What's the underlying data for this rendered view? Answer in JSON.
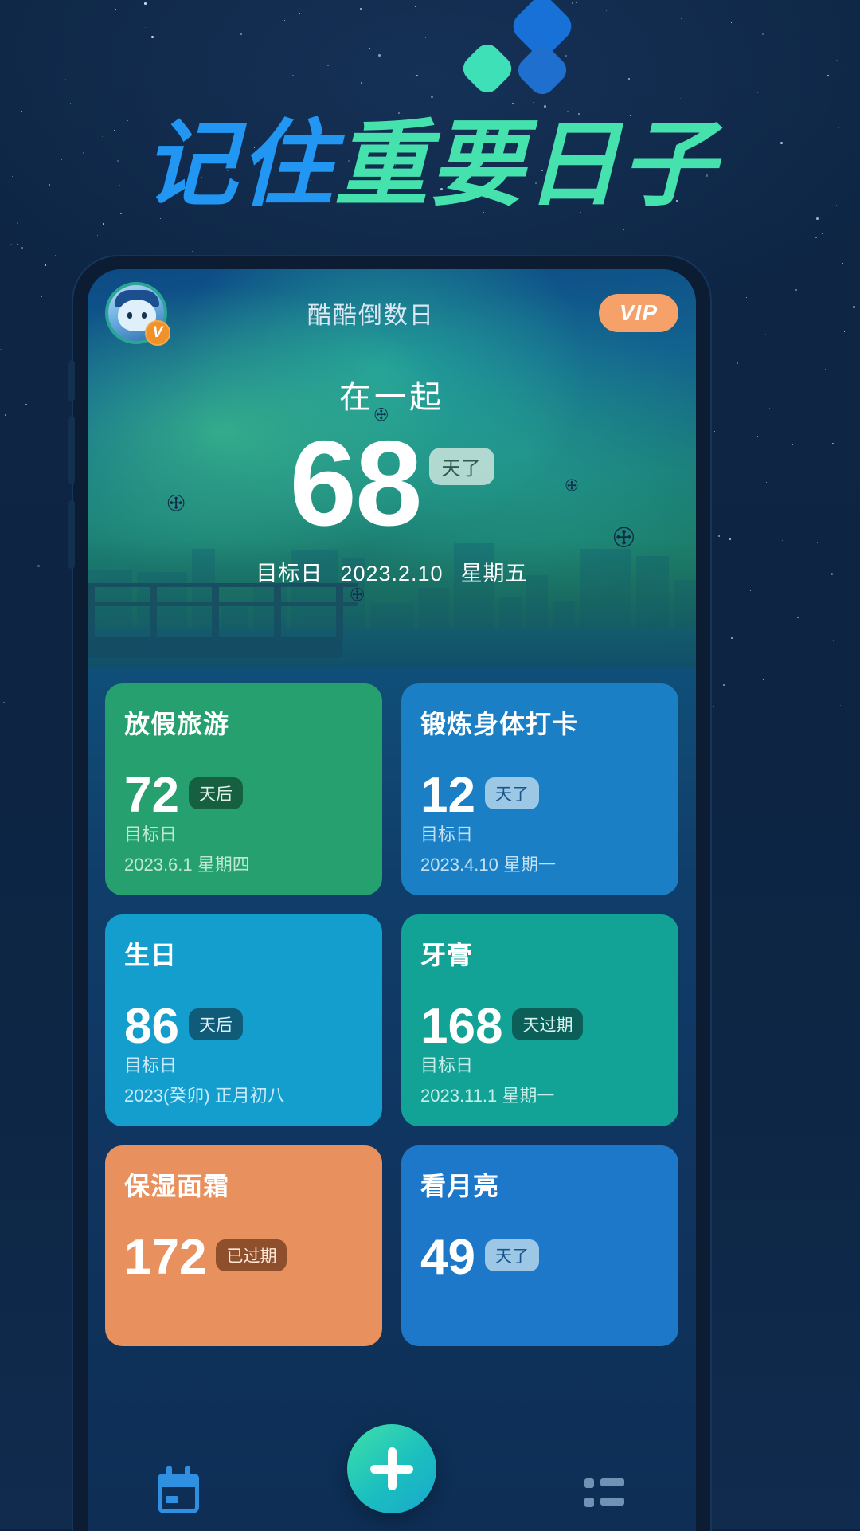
{
  "headline": {
    "part1": "记住",
    "part2": "重要日子",
    "color1": "#2196f3",
    "color2": "#45e2ad"
  },
  "app": {
    "title": "酷酷倒数日",
    "vip_label": "VIP",
    "avatar_badge": "V"
  },
  "hero": {
    "title": "在一起",
    "number": "68",
    "unit": "天了",
    "date_label": "目标日",
    "date": "2023.2.10",
    "weekday": "星期五"
  },
  "cards": [
    {
      "title": "放假旅游",
      "number": "72",
      "unit": "天后",
      "date_label": "目标日",
      "date": "2023.6.1 星期四",
      "color": "#26a06e",
      "theme": "c-green"
    },
    {
      "title": "锻炼身体打卡",
      "number": "12",
      "unit": "天了",
      "date_label": "目标日",
      "date": "2023.4.10 星期一",
      "color": "#1a7fc4",
      "theme": "c-blue"
    },
    {
      "title": "生日",
      "number": "86",
      "unit": "天后",
      "date_label": "目标日",
      "date": "2023(癸卯) 正月初八",
      "color": "#139ece",
      "theme": "c-cyan"
    },
    {
      "title": "牙膏",
      "number": "168",
      "unit": "天过期",
      "date_label": "目标日",
      "date": "2023.11.1 星期一",
      "color": "#12a396",
      "theme": "c-teal"
    },
    {
      "title": "保湿面霜",
      "number": "172",
      "unit": "已过期",
      "date_label": "",
      "date": "",
      "color": "#e8915f",
      "theme": "c-orange"
    },
    {
      "title": "看月亮",
      "number": "49",
      "unit": "天了",
      "date_label": "",
      "date": "",
      "color": "#1d78c9",
      "theme": "c-blue2"
    }
  ],
  "nav": {
    "calendar_icon": "calendar-icon",
    "add_icon": "plus-icon",
    "list_icon": "list-icon"
  }
}
